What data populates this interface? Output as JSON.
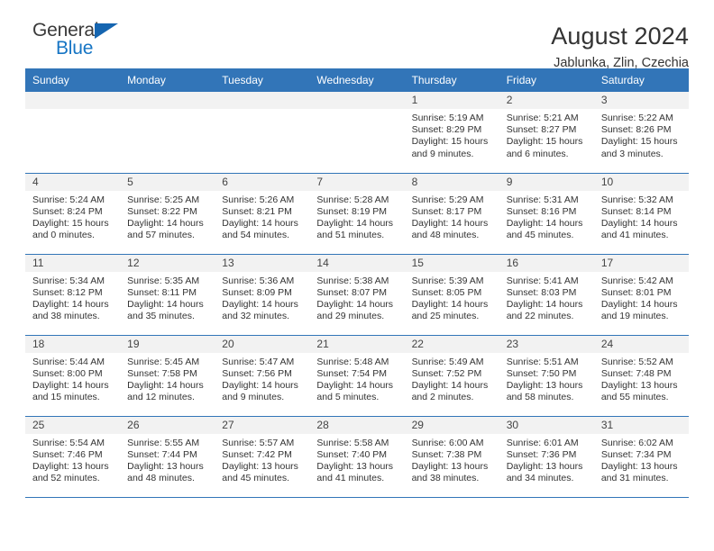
{
  "logo": {
    "word_top": "General",
    "word_bottom": "Blue",
    "triangle_color": "#1565b0",
    "blue_text_color": "#1675c4"
  },
  "header": {
    "title": "August 2024",
    "subtitle": "Jablunka, Zlin, Czechia"
  },
  "calendar": {
    "accent_color": "#3275b8",
    "daynum_bg": "#f2f2f2",
    "weekday_headers": [
      "Sunday",
      "Monday",
      "Tuesday",
      "Wednesday",
      "Thursday",
      "Friday",
      "Saturday"
    ],
    "weeks": [
      [
        {
          "day": "",
          "sunrise": "",
          "sunset": "",
          "daylight_line1": "",
          "daylight_line2": ""
        },
        {
          "day": "",
          "sunrise": "",
          "sunset": "",
          "daylight_line1": "",
          "daylight_line2": ""
        },
        {
          "day": "",
          "sunrise": "",
          "sunset": "",
          "daylight_line1": "",
          "daylight_line2": ""
        },
        {
          "day": "",
          "sunrise": "",
          "sunset": "",
          "daylight_line1": "",
          "daylight_line2": ""
        },
        {
          "day": "1",
          "sunrise": "Sunrise: 5:19 AM",
          "sunset": "Sunset: 8:29 PM",
          "daylight_line1": "Daylight: 15 hours",
          "daylight_line2": "and 9 minutes."
        },
        {
          "day": "2",
          "sunrise": "Sunrise: 5:21 AM",
          "sunset": "Sunset: 8:27 PM",
          "daylight_line1": "Daylight: 15 hours",
          "daylight_line2": "and 6 minutes."
        },
        {
          "day": "3",
          "sunrise": "Sunrise: 5:22 AM",
          "sunset": "Sunset: 8:26 PM",
          "daylight_line1": "Daylight: 15 hours",
          "daylight_line2": "and 3 minutes."
        }
      ],
      [
        {
          "day": "4",
          "sunrise": "Sunrise: 5:24 AM",
          "sunset": "Sunset: 8:24 PM",
          "daylight_line1": "Daylight: 15 hours",
          "daylight_line2": "and 0 minutes."
        },
        {
          "day": "5",
          "sunrise": "Sunrise: 5:25 AM",
          "sunset": "Sunset: 8:22 PM",
          "daylight_line1": "Daylight: 14 hours",
          "daylight_line2": "and 57 minutes."
        },
        {
          "day": "6",
          "sunrise": "Sunrise: 5:26 AM",
          "sunset": "Sunset: 8:21 PM",
          "daylight_line1": "Daylight: 14 hours",
          "daylight_line2": "and 54 minutes."
        },
        {
          "day": "7",
          "sunrise": "Sunrise: 5:28 AM",
          "sunset": "Sunset: 8:19 PM",
          "daylight_line1": "Daylight: 14 hours",
          "daylight_line2": "and 51 minutes."
        },
        {
          "day": "8",
          "sunrise": "Sunrise: 5:29 AM",
          "sunset": "Sunset: 8:17 PM",
          "daylight_line1": "Daylight: 14 hours",
          "daylight_line2": "and 48 minutes."
        },
        {
          "day": "9",
          "sunrise": "Sunrise: 5:31 AM",
          "sunset": "Sunset: 8:16 PM",
          "daylight_line1": "Daylight: 14 hours",
          "daylight_line2": "and 45 minutes."
        },
        {
          "day": "10",
          "sunrise": "Sunrise: 5:32 AM",
          "sunset": "Sunset: 8:14 PM",
          "daylight_line1": "Daylight: 14 hours",
          "daylight_line2": "and 41 minutes."
        }
      ],
      [
        {
          "day": "11",
          "sunrise": "Sunrise: 5:34 AM",
          "sunset": "Sunset: 8:12 PM",
          "daylight_line1": "Daylight: 14 hours",
          "daylight_line2": "and 38 minutes."
        },
        {
          "day": "12",
          "sunrise": "Sunrise: 5:35 AM",
          "sunset": "Sunset: 8:11 PM",
          "daylight_line1": "Daylight: 14 hours",
          "daylight_line2": "and 35 minutes."
        },
        {
          "day": "13",
          "sunrise": "Sunrise: 5:36 AM",
          "sunset": "Sunset: 8:09 PM",
          "daylight_line1": "Daylight: 14 hours",
          "daylight_line2": "and 32 minutes."
        },
        {
          "day": "14",
          "sunrise": "Sunrise: 5:38 AM",
          "sunset": "Sunset: 8:07 PM",
          "daylight_line1": "Daylight: 14 hours",
          "daylight_line2": "and 29 minutes."
        },
        {
          "day": "15",
          "sunrise": "Sunrise: 5:39 AM",
          "sunset": "Sunset: 8:05 PM",
          "daylight_line1": "Daylight: 14 hours",
          "daylight_line2": "and 25 minutes."
        },
        {
          "day": "16",
          "sunrise": "Sunrise: 5:41 AM",
          "sunset": "Sunset: 8:03 PM",
          "daylight_line1": "Daylight: 14 hours",
          "daylight_line2": "and 22 minutes."
        },
        {
          "day": "17",
          "sunrise": "Sunrise: 5:42 AM",
          "sunset": "Sunset: 8:01 PM",
          "daylight_line1": "Daylight: 14 hours",
          "daylight_line2": "and 19 minutes."
        }
      ],
      [
        {
          "day": "18",
          "sunrise": "Sunrise: 5:44 AM",
          "sunset": "Sunset: 8:00 PM",
          "daylight_line1": "Daylight: 14 hours",
          "daylight_line2": "and 15 minutes."
        },
        {
          "day": "19",
          "sunrise": "Sunrise: 5:45 AM",
          "sunset": "Sunset: 7:58 PM",
          "daylight_line1": "Daylight: 14 hours",
          "daylight_line2": "and 12 minutes."
        },
        {
          "day": "20",
          "sunrise": "Sunrise: 5:47 AM",
          "sunset": "Sunset: 7:56 PM",
          "daylight_line1": "Daylight: 14 hours",
          "daylight_line2": "and 9 minutes."
        },
        {
          "day": "21",
          "sunrise": "Sunrise: 5:48 AM",
          "sunset": "Sunset: 7:54 PM",
          "daylight_line1": "Daylight: 14 hours",
          "daylight_line2": "and 5 minutes."
        },
        {
          "day": "22",
          "sunrise": "Sunrise: 5:49 AM",
          "sunset": "Sunset: 7:52 PM",
          "daylight_line1": "Daylight: 14 hours",
          "daylight_line2": "and 2 minutes."
        },
        {
          "day": "23",
          "sunrise": "Sunrise: 5:51 AM",
          "sunset": "Sunset: 7:50 PM",
          "daylight_line1": "Daylight: 13 hours",
          "daylight_line2": "and 58 minutes."
        },
        {
          "day": "24",
          "sunrise": "Sunrise: 5:52 AM",
          "sunset": "Sunset: 7:48 PM",
          "daylight_line1": "Daylight: 13 hours",
          "daylight_line2": "and 55 minutes."
        }
      ],
      [
        {
          "day": "25",
          "sunrise": "Sunrise: 5:54 AM",
          "sunset": "Sunset: 7:46 PM",
          "daylight_line1": "Daylight: 13 hours",
          "daylight_line2": "and 52 minutes."
        },
        {
          "day": "26",
          "sunrise": "Sunrise: 5:55 AM",
          "sunset": "Sunset: 7:44 PM",
          "daylight_line1": "Daylight: 13 hours",
          "daylight_line2": "and 48 minutes."
        },
        {
          "day": "27",
          "sunrise": "Sunrise: 5:57 AM",
          "sunset": "Sunset: 7:42 PM",
          "daylight_line1": "Daylight: 13 hours",
          "daylight_line2": "and 45 minutes."
        },
        {
          "day": "28",
          "sunrise": "Sunrise: 5:58 AM",
          "sunset": "Sunset: 7:40 PM",
          "daylight_line1": "Daylight: 13 hours",
          "daylight_line2": "and 41 minutes."
        },
        {
          "day": "29",
          "sunrise": "Sunrise: 6:00 AM",
          "sunset": "Sunset: 7:38 PM",
          "daylight_line1": "Daylight: 13 hours",
          "daylight_line2": "and 38 minutes."
        },
        {
          "day": "30",
          "sunrise": "Sunrise: 6:01 AM",
          "sunset": "Sunset: 7:36 PM",
          "daylight_line1": "Daylight: 13 hours",
          "daylight_line2": "and 34 minutes."
        },
        {
          "day": "31",
          "sunrise": "Sunrise: 6:02 AM",
          "sunset": "Sunset: 7:34 PM",
          "daylight_line1": "Daylight: 13 hours",
          "daylight_line2": "and 31 minutes."
        }
      ]
    ]
  }
}
